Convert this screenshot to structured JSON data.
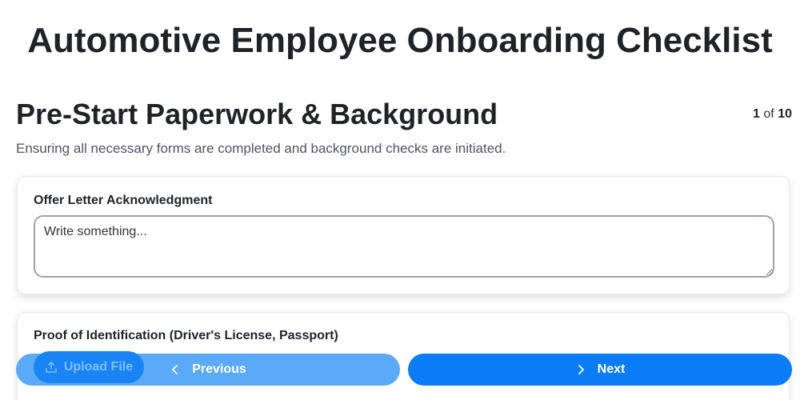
{
  "page": {
    "title": "Automotive Employee Onboarding Checklist"
  },
  "section": {
    "title": "Pre-Start Paperwork & Background",
    "subtitle": "Ensuring all necessary forms are completed and background checks are initiated."
  },
  "pager": {
    "current": "1",
    "of_label": "of",
    "total": "10"
  },
  "fields": [
    {
      "label": "Offer Letter Acknowledgment",
      "placeholder": "Write something...",
      "value": ""
    },
    {
      "label": "Proof of Identification (Driver's License, Passport)",
      "upload_label": "Upload File"
    }
  ],
  "navigation": {
    "previous_label": "Previous",
    "next_label": "Next"
  },
  "icons": {
    "upload": "upload-icon",
    "previous": "chevron-left-icon",
    "next": "chevron-right-icon"
  },
  "colors": {
    "primary": "#0a7cf5",
    "primary_disabled": "#5aaaf9",
    "text": "#1f2328",
    "muted_text": "#4b5563"
  }
}
